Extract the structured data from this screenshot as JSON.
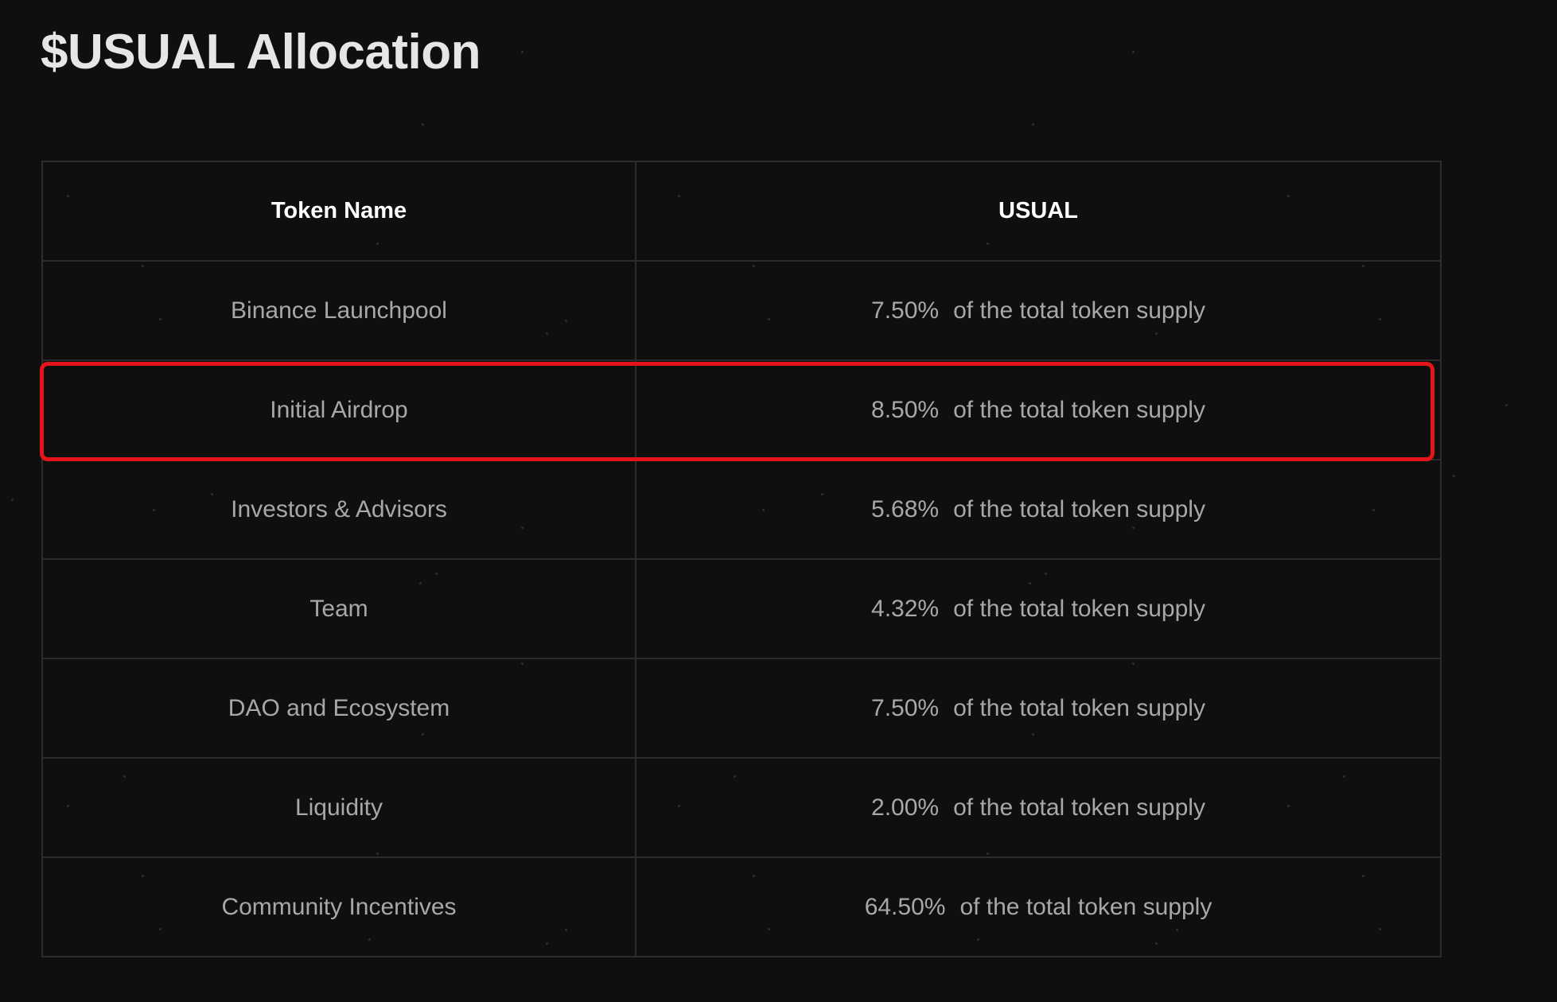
{
  "page": {
    "title": "$USUAL Allocation"
  },
  "table": {
    "headers": {
      "token_name": "Token Name",
      "usual": "USUAL"
    },
    "rows": [
      {
        "name": "Binance Launchpool",
        "percent": "7.50%",
        "suffix": "of the total token supply"
      },
      {
        "name": "Initial Airdrop",
        "percent": "8.50%",
        "suffix": "of the total token supply"
      },
      {
        "name": "Investors & Advisors",
        "percent": "5.68%",
        "suffix": "of the total token supply"
      },
      {
        "name": "Team",
        "percent": "4.32%",
        "suffix": "of the total token supply"
      },
      {
        "name": "DAO and Ecosystem",
        "percent": "7.50%",
        "suffix": "of the total token supply"
      },
      {
        "name": "Liquidity",
        "percent": "2.00%",
        "suffix": "of the total token supply"
      },
      {
        "name": "Community Incentives",
        "percent": "64.50%",
        "suffix": "of the total token supply"
      }
    ],
    "highlighted_row": "Initial Airdrop"
  },
  "colors": {
    "background": "#0f0f0f",
    "highlight": "#e3141a",
    "header_text": "#ffffff",
    "cell_text": "#a8a8a8"
  }
}
